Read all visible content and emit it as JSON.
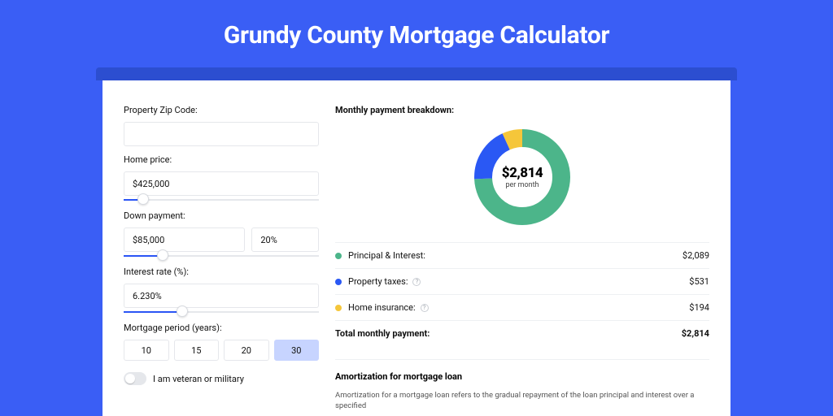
{
  "title": "Grundy County Mortgage Calculator",
  "form": {
    "zip": {
      "label": "Property Zip Code:",
      "value": "",
      "placeholder": ""
    },
    "home_price": {
      "label": "Home price:",
      "value": "$425,000",
      "slider_fill_pct": 10
    },
    "down_payment": {
      "label": "Down payment:",
      "value": "$85,000",
      "pct": "20%",
      "slider_fill_pct": 20
    },
    "interest": {
      "label": "Interest rate (%):",
      "value": "6.230%",
      "slider_fill_pct": 30
    },
    "period": {
      "label": "Mortgage period (years):",
      "options": [
        "10",
        "15",
        "20",
        "30"
      ],
      "active": "30"
    },
    "veteran_label": "I am veteran or military"
  },
  "breakdown": {
    "title": "Monthly payment breakdown:",
    "center_amount": "$2,814",
    "center_sub": "per month",
    "rows": [
      {
        "color": "g",
        "label": "Principal & Interest:",
        "hint": false,
        "value": "$2,089"
      },
      {
        "color": "b",
        "label": "Property taxes:",
        "hint": true,
        "value": "$531"
      },
      {
        "color": "y",
        "label": "Home insurance:",
        "hint": true,
        "value": "$194"
      }
    ],
    "total_label": "Total monthly payment:",
    "total_value": "$2,814"
  },
  "amort": {
    "title": "Amortization for mortgage loan",
    "text": "Amortization for a mortgage loan refers to the gradual repayment of the loan principal and interest over a specified"
  },
  "chart_data": {
    "type": "pie",
    "title": "Monthly payment breakdown",
    "series": [
      {
        "name": "Principal & Interest",
        "value": 2089,
        "color": "#4cb58a"
      },
      {
        "name": "Property taxes",
        "value": 531,
        "color": "#2a58f4"
      },
      {
        "name": "Home insurance",
        "value": 194,
        "color": "#f5c63a"
      }
    ],
    "total": 2814,
    "unit": "USD per month"
  }
}
